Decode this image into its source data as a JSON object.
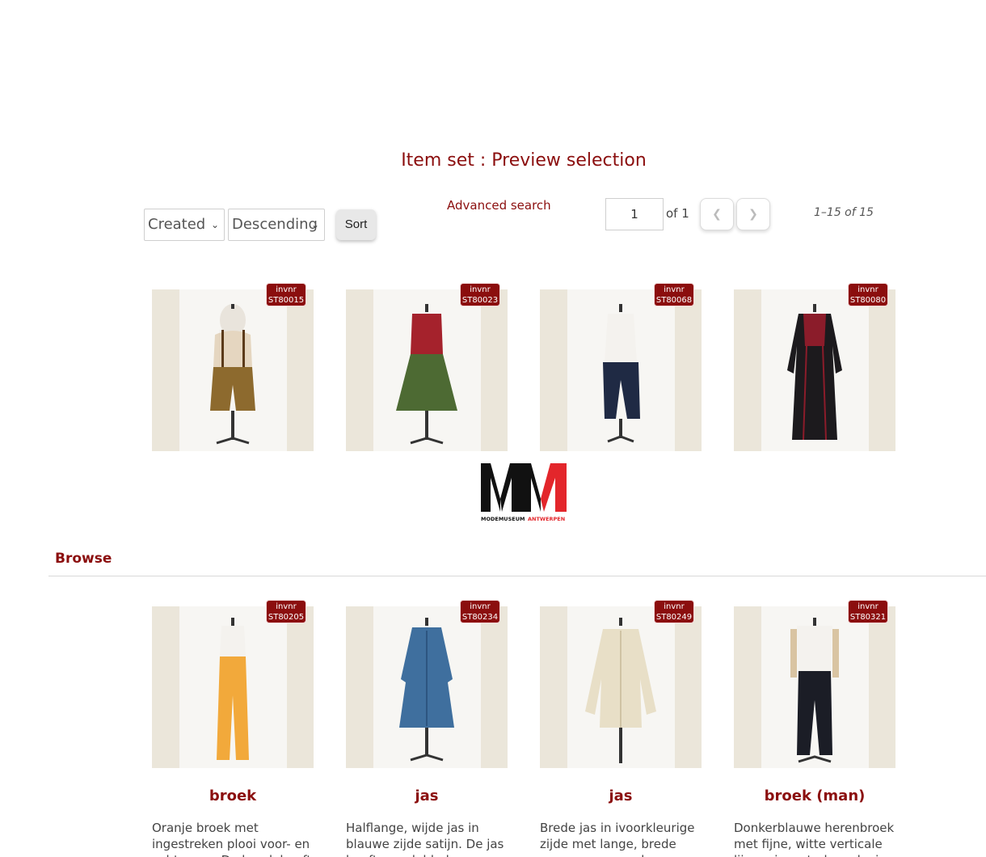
{
  "page": {
    "title": "Item set : Preview selection"
  },
  "sort": {
    "field": "Created",
    "order": "Descending",
    "button_label": "Sort"
  },
  "search": {
    "advanced_label": "Advanced search"
  },
  "pagination": {
    "current_page": "1",
    "of_label": "of 1",
    "prev_icon": "chevron-left-icon",
    "next_icon": "chevron-right-icon",
    "range_label": "1–15 of 15"
  },
  "badge_prefix": "invnr",
  "items": [
    {
      "invnr": "ST80015",
      "garment": "lederhosen-with-suspenders"
    },
    {
      "invnr": "ST80023",
      "garment": "red-bodice-green-skirt-dress"
    },
    {
      "invnr": "ST80068",
      "garment": "dark-trousers"
    },
    {
      "invnr": "ST80080",
      "garment": "black-and-red-long-dress"
    }
  ],
  "logo": {
    "letters": "MM",
    "text": "MODEMUSEUM ANTWERPEN"
  },
  "browse": {
    "title": "Browse",
    "items": [
      {
        "invnr": "ST80205",
        "title": "broek",
        "description": "Oranje broek met ingestreken plooi voor- en achteraan. De broek heeft",
        "garment": "orange-trousers"
      },
      {
        "invnr": "ST80234",
        "title": "jas",
        "description": "Halflange, wijde jas in blauwe zijde satijn. De jas heeft een dubbele",
        "garment": "blue-coat"
      },
      {
        "invnr": "ST80249",
        "title": "jas",
        "description": "Brede jas in ivoorkleurige zijde met lange, brede mouwen en een kraag",
        "garment": "ivory-jacket"
      },
      {
        "invnr": "ST80321",
        "title": "broek (man)",
        "description": "Donkerblauwe herenbroek met fijne, witte verticale lijnen, ingestreken plooi",
        "garment": "navy-mens-trousers"
      }
    ]
  },
  "colors": {
    "accent": "#8b0e0e",
    "thumb_bg": "#ebe6da",
    "logo_red": "#e3262b"
  }
}
